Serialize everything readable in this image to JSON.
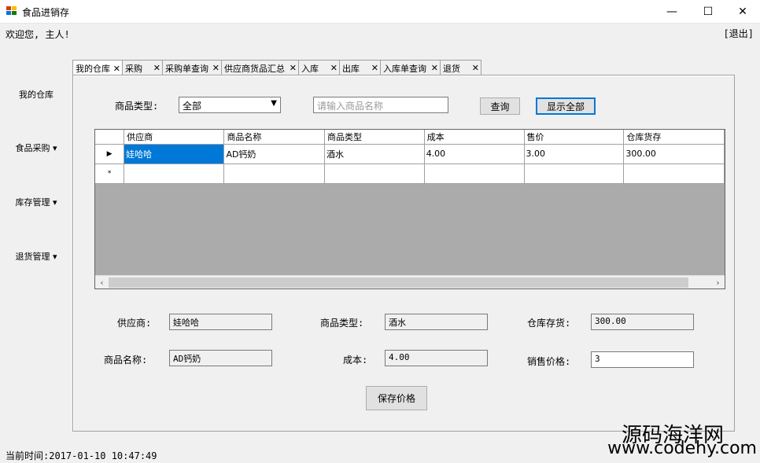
{
  "window": {
    "title": "食品进销存",
    "minimize": "—",
    "maximize": "☐",
    "close": "✕"
  },
  "header": {
    "welcome": "欢迎您, 主人!",
    "logout": "[退出]"
  },
  "sidebar": {
    "items": [
      {
        "label": "我的仓库"
      },
      {
        "label": "食品采购 ▾"
      },
      {
        "label": "库存管理 ▾"
      },
      {
        "label": "退货管理 ▾"
      }
    ]
  },
  "tabs": [
    {
      "label": "我的仓库"
    },
    {
      "label": "采购"
    },
    {
      "label": "采购单查询"
    },
    {
      "label": "供应商货品汇总"
    },
    {
      "label": "入库"
    },
    {
      "label": "出库"
    },
    {
      "label": "入库单查询"
    },
    {
      "label": "退货"
    }
  ],
  "tab_close": "✕",
  "filter": {
    "type_label": "商品类型:",
    "type_value": "全部",
    "search_placeholder": "请输入商品名称",
    "query_button": "查询",
    "show_all_button": "显示全部"
  },
  "grid": {
    "columns": [
      "供应商",
      "商品名称",
      "商品类型",
      "成本",
      "售价",
      "仓库货存"
    ],
    "rows": [
      [
        "娃哈哈",
        "AD钙奶",
        "酒水",
        "4.00",
        "3.00",
        "300.00"
      ]
    ],
    "row_marker": "▶",
    "new_marker": "*",
    "scroll_left": "‹",
    "scroll_right": "›"
  },
  "detail": {
    "supplier_label": "供应商:",
    "supplier_value": "娃哈哈",
    "type_label": "商品类型:",
    "type_value": "酒水",
    "stock_label": "仓库存货:",
    "stock_value": "300.00",
    "name_label": "商品名称:",
    "name_value": "AD钙奶",
    "cost_label": "成本:",
    "cost_value": "4.00",
    "price_label": "销售价格:",
    "price_value": "3",
    "save_button": "保存价格"
  },
  "status": {
    "time": "当前时间:2017-01-10 10:47:49"
  },
  "watermark": {
    "title": "源码海洋网",
    "url": "www.codehy.com"
  },
  "colors": {
    "selection": "#0078d7",
    "focus_border": "#0078d7",
    "grid_background": "#ababab"
  }
}
